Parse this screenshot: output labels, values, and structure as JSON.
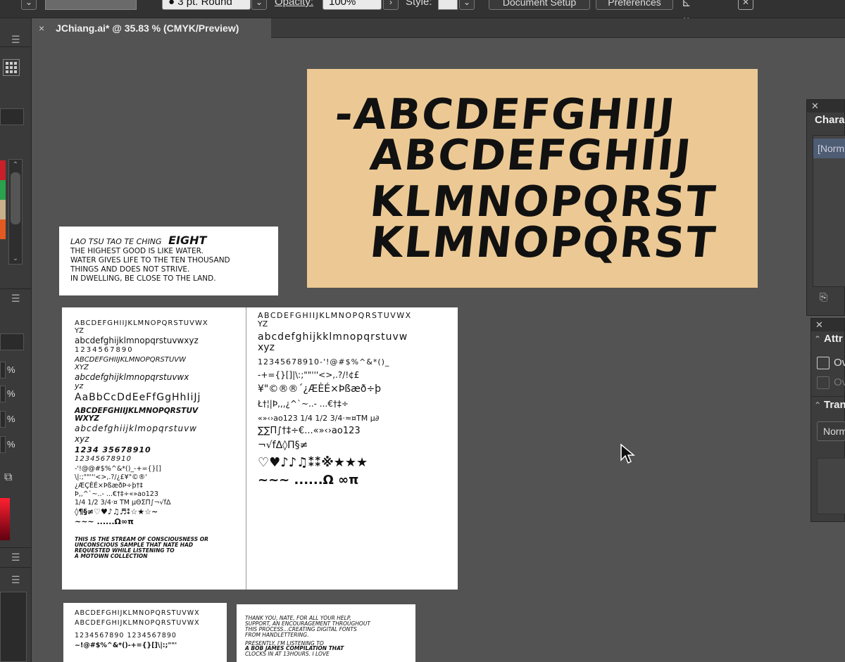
{
  "toolbar": {
    "stroke_value": "3 pt. Round",
    "opacity_label": "Opacity:",
    "opacity_value": "100%",
    "style_label": "Style:",
    "document_setup": "Document Setup",
    "preferences": "Preferences"
  },
  "document_tab": {
    "close": "×",
    "title": "JChiang.ai* @ 35.83 % (CMYK/Preview)"
  },
  "left_dock": {
    "percent_labels": [
      "%",
      "%",
      "%",
      "%"
    ],
    "swatches": [
      "#c8202a",
      "#2aa24e",
      "#c8b08a",
      "#e35a20"
    ]
  },
  "artboard_main": {
    "lines": [
      "-ABCDEFGHIIJ",
      "ABCDEFGHIIJ",
      "KLMNOPQRST",
      "KLMNOPQRST"
    ],
    "color": "#ecc994"
  },
  "paper_lao_tsu": {
    "lines": [
      "LAO TSU TAO TE CHING",
      "EIGHT",
      "THE HIGHEST GOOD IS LIKE WATER.",
      "WATER GIVES LIFE TO THE TEN THOUSAND",
      "THINGS AND DOES NOT STRIVE.",
      "IN DWELLING, BE CLOSE TO THE LAND."
    ]
  },
  "paper_left_samples": {
    "lines": [
      "ABCDEFGHIIJKLMNOPQRSTUVWX",
      "YZ",
      "abcdefghijklmnopqrstuvwxyz",
      "1234567890",
      "ABCDEFGHIIJKLMNOPQRSTUVW",
      "XYZ",
      "abcdefghijklmnopqrstuvwx",
      "yz",
      "AaBbCcDdEeFfGgHhIiJj",
      "ABCDEFGHIIJKLMNOPQRSTUV",
      "WXYZ",
      "abcdefghiijklmopqrstuvw",
      "xyz",
      "1234 35678910",
      "12345678910",
      "-'!@@#$%^&*()_-+={}[]",
      "\\|:;\"\"'''<>,.?/¿£¥\"©®'",
      "¿ÆÇÈÉ×ÞßæðÞ÷þ†‡",
      "Þ,,^`~..- ...€†‡÷«»ao123",
      "1/4 1/2 3/4·¤ TM µΘΣΠ∫¬√fΔ",
      "◊¶§≠♡♥♪♫♬⁑☆★☆~",
      "~~~ ......Ω∞π",
      "THIS IS THE STREAM OF CONSCIOUSNESS OR",
      "UNCONSCIOUS SAMPLE THAT NATE HAD",
      "REQUESTED WHILE LISTENING TO",
      "A MOTOWN COLLECTION"
    ]
  },
  "paper_right_samples": {
    "lines": [
      "ABCDEFGHIIJKLMNOPQRSTUVWX",
      "YZ",
      "abcdefghijkklmnopqrstuvw",
      "xyz",
      "12345678910-'!@#$%^&*()_",
      "-+={}[]|\\:;\"\"'''<>,.?/!¢£",
      "¥\"©®®´¿ÆÈÉ×Þßæð÷þ",
      "Ł†¦|Þ,,,¿^`~..- ...€†‡÷",
      "«»‹›ao123 1/4 1/2 3/4·≈¤TM µ∂",
      "∑∑Π∫†‡÷€...«»‹›ao123",
      "¬√fΔ◊Π§≠",
      "♡♥♪♪♫⁑⁑※★★★",
      "~~~ ......Ω ∞π"
    ]
  },
  "paper_bottom_left": {
    "lines": [
      "ABCDEFGHIJKLMNOPQRSTUVWX",
      "ABCDEFGHIJKLMNOPQRSTUVWX",
      "1234567890 1234567890",
      "~!@#$%^&*()-+={}[]\\|:;\"\"'"
    ]
  },
  "paper_bottom_right": {
    "lines": [
      "THANK YOU, NATE, FOR ALL YOUR HELP,",
      "SUPPORT, AN ENCOURAGEMENT THROUGHOUT",
      "THIS PROCESS...CREATING DIGITAL FONTS",
      "FROM HANDLETTERING.",
      "PRESENTLY, I'M LISTENING TO",
      "A BOB JAMES COMPILATION THAT",
      "CLOCKS IN AT 13HOURS. I LOVE"
    ]
  },
  "character_panel": {
    "title": "Chara",
    "style": "[Norm"
  },
  "attributes_panel": {
    "title": "Attr",
    "checkbox1": "Ov",
    "checkbox2": "Ov"
  },
  "transparency_panel": {
    "title": "Tran",
    "blend": "Norm"
  }
}
